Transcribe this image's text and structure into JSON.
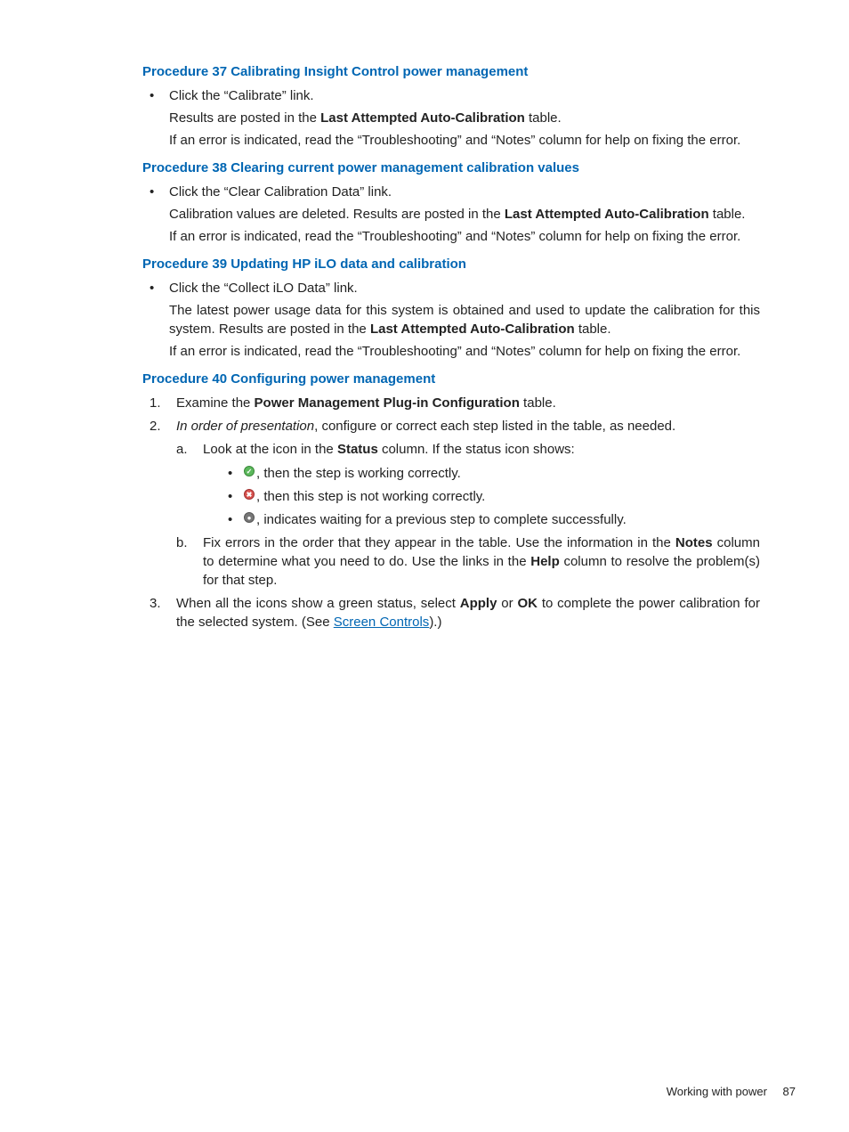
{
  "proc37": {
    "title": "Procedure 37 Calibrating Insight Control power management",
    "b1": "Click the “Calibrate” link.",
    "p1a": "Results are posted in the ",
    "p1b": "Last Attempted Auto-Calibration",
    "p1c": " table.",
    "p2": "If an error is indicated, read the “Troubleshooting” and “Notes” column for help on fixing the error."
  },
  "proc38": {
    "title": "Procedure 38 Clearing current power management calibration values",
    "b1": "Click the “Clear Calibration Data” link.",
    "p1a": "Calibration values are deleted. Results are posted in the ",
    "p1b": "Last Attempted Auto-Calibration",
    "p1c": " table.",
    "p2": "If an error is indicated, read the “Troubleshooting” and “Notes” column for help on fixing the error."
  },
  "proc39": {
    "title": "Procedure 39 Updating HP iLO data and calibration",
    "b1": "Click the “Collect iLO Data” link.",
    "p1a": "The latest power usage data for this system is obtained and used to update the calibration for this system. Results are posted in the ",
    "p1b": "Last Attempted Auto-Calibration",
    "p1c": " table.",
    "p2": "If an error is indicated, read the “Troubleshooting” and “Notes” column for help on fixing the error."
  },
  "proc40": {
    "title": "Procedure 40 Configuring power management",
    "s1a": "Examine the ",
    "s1b": "Power Management Plug-in Configuration",
    "s1c": " table.",
    "s2a": "In order of presentation",
    "s2b": ", configure or correct each step listed in the table, as needed.",
    "s2a_a": "Look at the icon in the ",
    "s2a_b": "Status",
    "s2a_c": " column. If the status icon shows:",
    "ic1": ", then the step is working correctly.",
    "ic2": ", then this step is not working correctly.",
    "ic3": ", indicates waiting for a previous step to complete successfully.",
    "s2b_a": "Fix errors in the order that they appear in the table. Use the information in the ",
    "s2b_b": "Notes",
    "s2b_c": " column to determine what you need to do. Use the links in the ",
    "s2b_d": "Help",
    "s2b_e": " column to resolve the problem(s) for that step.",
    "s3a": "When all the icons show a green status, select ",
    "s3b": "Apply",
    "s3c": " or ",
    "s3d": "OK",
    "s3e": " to complete the power calibration for the selected system. (See ",
    "s3f": "Screen Controls",
    "s3g": ").)"
  },
  "footer": {
    "text": "Working with power",
    "page": "87"
  },
  "nums": {
    "n1": "1.",
    "n2": "2.",
    "n3": "3.",
    "la": "a.",
    "lb": "b."
  },
  "iconglyph": {
    "ok": "✓",
    "err": "✖",
    "wait": "●"
  }
}
